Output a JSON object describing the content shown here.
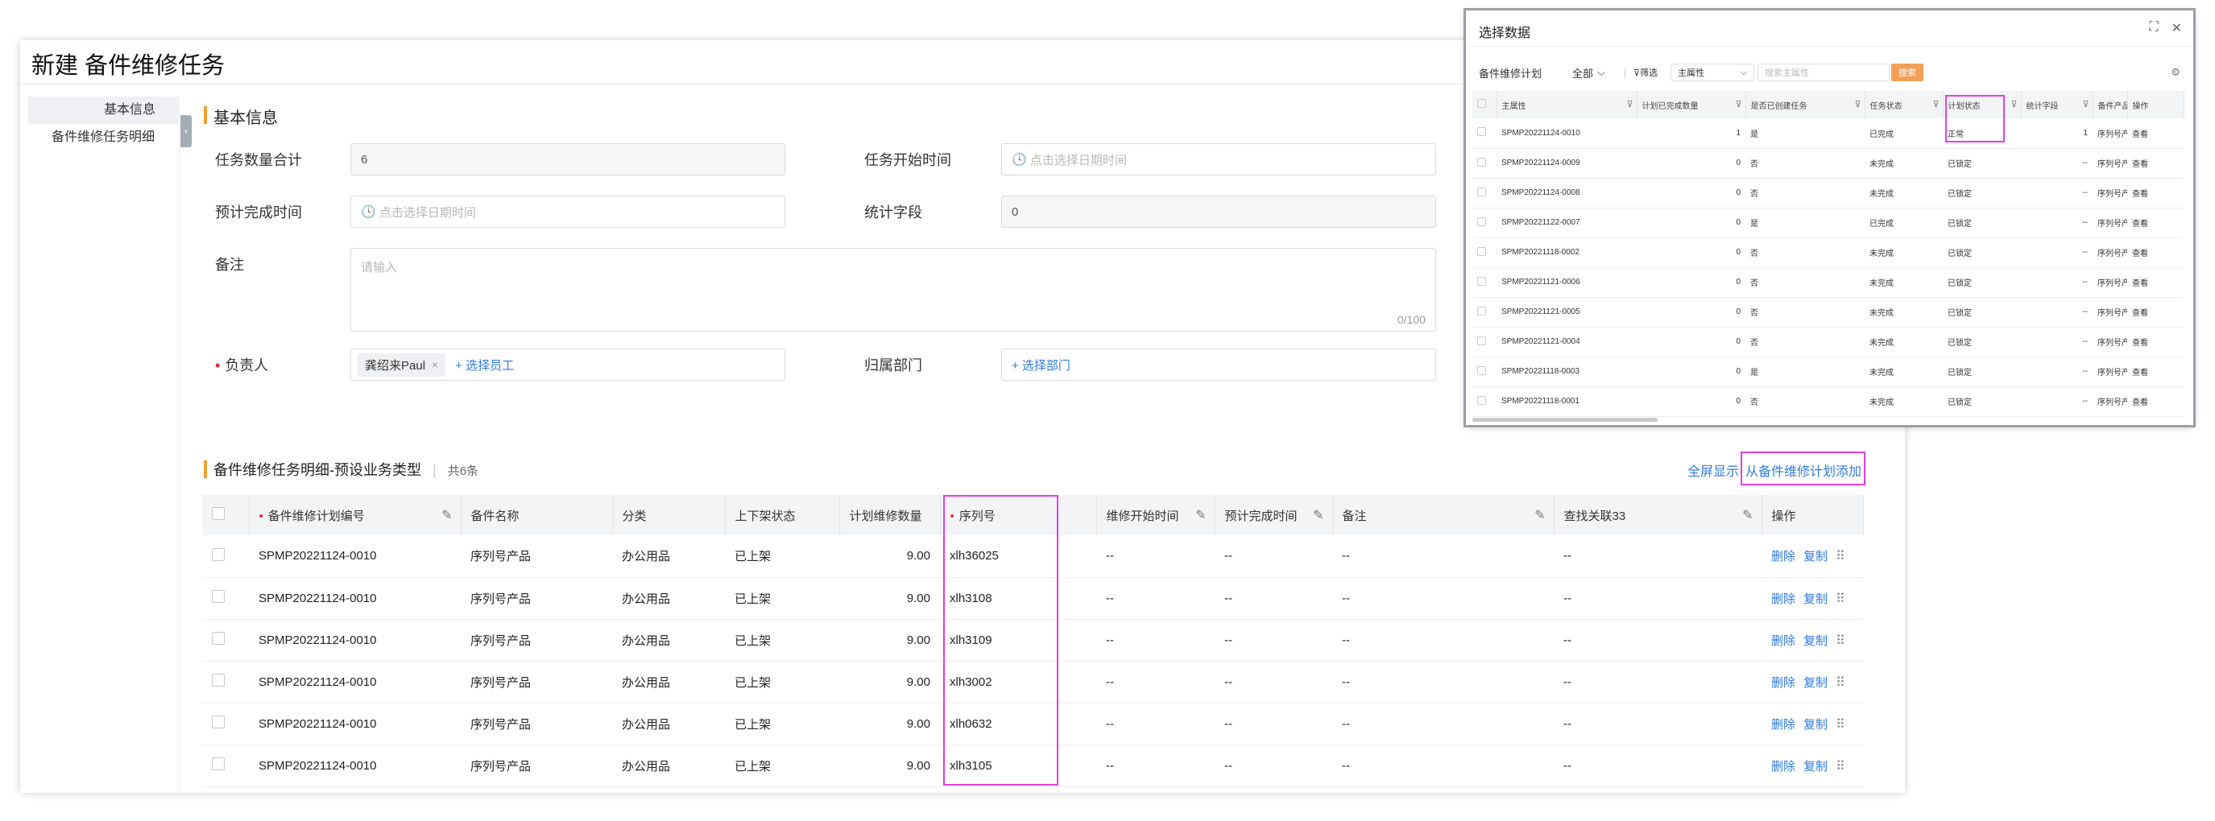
{
  "page": {
    "title": "新建 备件维修任务"
  },
  "sidebar": {
    "items": [
      {
        "label": "基本信息"
      },
      {
        "label": "备件维修任务明细"
      }
    ]
  },
  "basic": {
    "section_title": "基本信息",
    "task_count": {
      "label": "任务数量合计",
      "value": "6"
    },
    "start_time": {
      "label": "任务开始时间",
      "placeholder": "点击选择日期时间"
    },
    "expected_end": {
      "label": "预计完成时间",
      "placeholder": "点击选择日期时间"
    },
    "stat_field": {
      "label": "统计字段",
      "value": "0"
    },
    "remark": {
      "label": "备注",
      "placeholder": "请输入",
      "counter": "0/100"
    },
    "owner": {
      "label": "负责人",
      "tag": "龚绍来Paul",
      "add": "+ 选择员工"
    },
    "dept": {
      "label": "归属部门",
      "add": "+ 选择部门"
    }
  },
  "detail": {
    "section_title": "备件维修任务明细-预设业务类型",
    "count": "共6条",
    "fullscreen": "全屏显示",
    "add_from_plan": "从备件维修计划添加",
    "columns": [
      "备件维修计划编号",
      "备件名称",
      "分类",
      "上下架状态",
      "计划维修数量",
      "序列号",
      "维修开始时间",
      "预计完成时间",
      "备注",
      "查找关联33",
      "操作"
    ],
    "rows": [
      {
        "plan_no": "SPMP20221124-0010",
        "name": "序列号产品",
        "category": "办公用品",
        "shelf": "已上架",
        "qty": "9.00",
        "serial": "xlh36025",
        "start": "--",
        "end": "--",
        "remark": "--",
        "lookup": "--"
      },
      {
        "plan_no": "SPMP20221124-0010",
        "name": "序列号产品",
        "category": "办公用品",
        "shelf": "已上架",
        "qty": "9.00",
        "serial": "xlh3108",
        "start": "--",
        "end": "--",
        "remark": "--",
        "lookup": "--"
      },
      {
        "plan_no": "SPMP20221124-0010",
        "name": "序列号产品",
        "category": "办公用品",
        "shelf": "已上架",
        "qty": "9.00",
        "serial": "xlh3109",
        "start": "--",
        "end": "--",
        "remark": "--",
        "lookup": "--"
      },
      {
        "plan_no": "SPMP20221124-0010",
        "name": "序列号产品",
        "category": "办公用品",
        "shelf": "已上架",
        "qty": "9.00",
        "serial": "xlh3002",
        "start": "--",
        "end": "--",
        "remark": "--",
        "lookup": "--"
      },
      {
        "plan_no": "SPMP20221124-0010",
        "name": "序列号产品",
        "category": "办公用品",
        "shelf": "已上架",
        "qty": "9.00",
        "serial": "xlh0632",
        "start": "--",
        "end": "--",
        "remark": "--",
        "lookup": "--"
      },
      {
        "plan_no": "SPMP20221124-0010",
        "name": "序列号产品",
        "category": "办公用品",
        "shelf": "已上架",
        "qty": "9.00",
        "serial": "xlh3105",
        "start": "--",
        "end": "--",
        "remark": "--",
        "lookup": "--"
      }
    ],
    "actions": {
      "delete": "删除",
      "copy": "复制"
    }
  },
  "dialog": {
    "title": "选择数据",
    "plan_label": "备件维修计划",
    "scope": "全部",
    "filter": "筛选",
    "field": "主属性",
    "search_placeholder": "搜索主属性",
    "search_btn": "搜索",
    "columns": [
      "主属性",
      "计划已完成数量",
      "是否已创建任务",
      "任务状态",
      "计划状态",
      "统计字段",
      "备件产品",
      "操作"
    ],
    "rows": [
      {
        "id": "SPMP20221124-0010",
        "done": "1",
        "created": "是",
        "task": "已完成",
        "plan": "正常",
        "stat": "1",
        "product": "序列号产",
        "view": "查看"
      },
      {
        "id": "SPMP20221124-0009",
        "done": "0",
        "created": "否",
        "task": "未完成",
        "plan": "已锁定",
        "stat": "--",
        "product": "序列号产",
        "view": "查看"
      },
      {
        "id": "SPMP20221124-0008",
        "done": "0",
        "created": "否",
        "task": "未完成",
        "plan": "已锁定",
        "stat": "--",
        "product": "序列号产",
        "view": "查看"
      },
      {
        "id": "SPMP20221122-0007",
        "done": "0",
        "created": "是",
        "task": "已完成",
        "plan": "已锁定",
        "stat": "--",
        "product": "序列号产",
        "view": "查看"
      },
      {
        "id": "SPMP20221118-0002",
        "done": "0",
        "created": "否",
        "task": "未完成",
        "plan": "已锁定",
        "stat": "--",
        "product": "序列号产",
        "view": "查看"
      },
      {
        "id": "SPMP20221121-0006",
        "done": "0",
        "created": "否",
        "task": "未完成",
        "plan": "已锁定",
        "stat": "--",
        "product": "序列号产",
        "view": "查看"
      },
      {
        "id": "SPMP20221121-0005",
        "done": "0",
        "created": "否",
        "task": "未完成",
        "plan": "已锁定",
        "stat": "--",
        "product": "序列号产",
        "view": "查看"
      },
      {
        "id": "SPMP20221121-0004",
        "done": "0",
        "created": "否",
        "task": "未完成",
        "plan": "已锁定",
        "stat": "--",
        "product": "序列号产",
        "view": "查看"
      },
      {
        "id": "SPMP20221118-0003",
        "done": "0",
        "created": "是",
        "task": "未完成",
        "plan": "已锁定",
        "stat": "--",
        "product": "序列号产",
        "view": "查看"
      },
      {
        "id": "SPMP20221118-0001",
        "done": "0",
        "created": "否",
        "task": "未完成",
        "plan": "已锁定",
        "stat": "--",
        "product": "序列号产",
        "view": "查看"
      }
    ]
  },
  "colors": {
    "accent": "#f0a02d",
    "link": "#2e7ae6",
    "highlight": "#e040e0",
    "search": "#f2a057"
  }
}
